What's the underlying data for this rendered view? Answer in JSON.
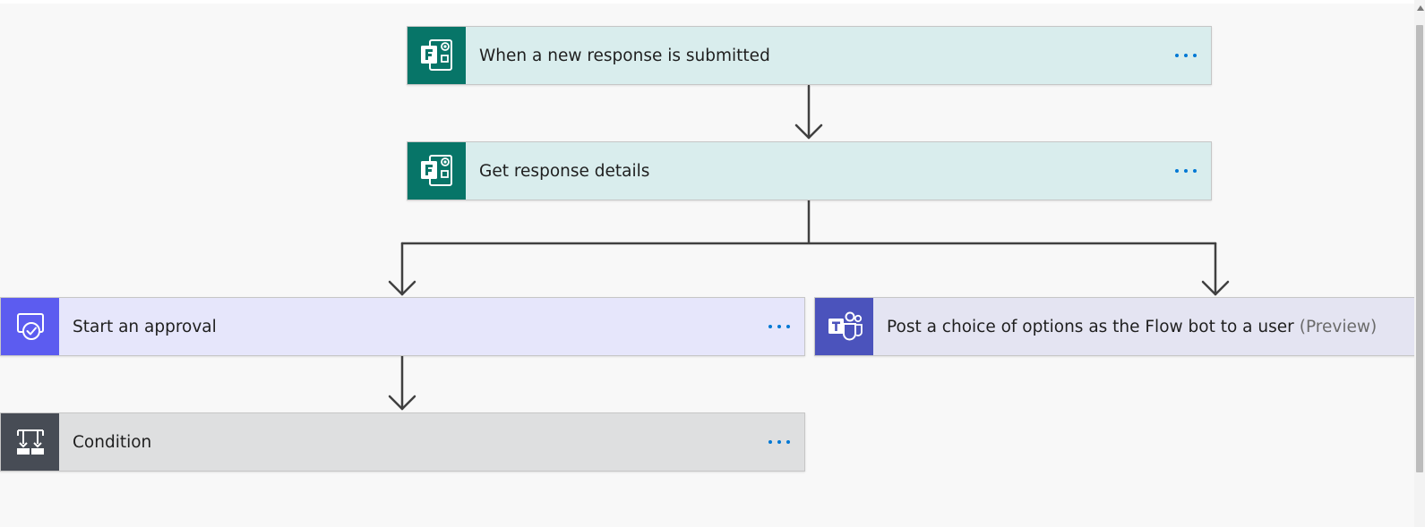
{
  "steps": {
    "trigger": {
      "title": "When a new response is submitted",
      "icon": "forms-icon",
      "color": "#077568"
    },
    "get_details": {
      "title": "Get response details",
      "icon": "forms-icon",
      "color": "#077568"
    },
    "approval": {
      "title": "Start an approval",
      "icon": "approval-icon",
      "color": "#5c5cf0"
    },
    "teams_post": {
      "title": "Post a choice of options as the Flow bot to a user",
      "suffix": "(Preview)",
      "icon": "teams-icon",
      "color": "#4b53bc"
    },
    "condition": {
      "title": "Condition",
      "icon": "condition-icon",
      "color": "#474c55"
    }
  },
  "more_options_icon": "more-options-icon",
  "connector_color": "#404040",
  "link_color": "#0078d4"
}
